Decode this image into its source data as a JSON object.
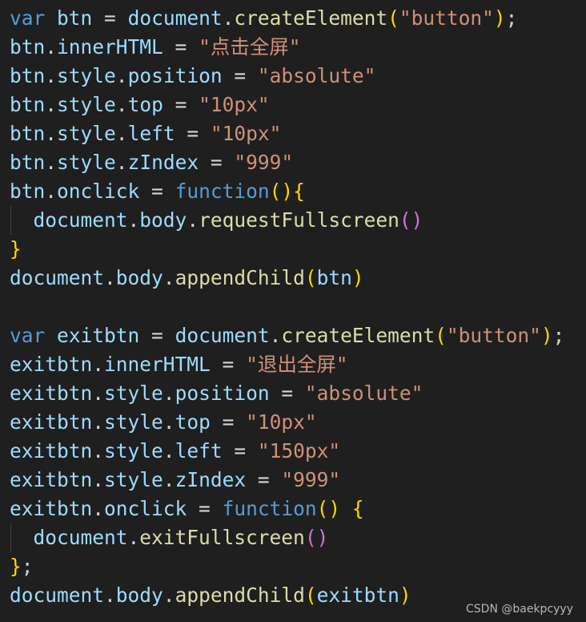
{
  "colors": {
    "background": "#1f1f1f",
    "keyword": "#569cd6",
    "variable": "#9cdcfe",
    "function": "#dcdcaa",
    "string": "#ce9178",
    "operator": "#d4d4d4",
    "bracket_level_1": "#ffd700",
    "bracket_level_2": "#da70d6",
    "indent_guide": "#404040"
  },
  "code": {
    "lines": [
      {
        "indent": false,
        "tokens": [
          [
            "var",
            "kw"
          ],
          [
            " ",
            "op"
          ],
          [
            "btn",
            "var"
          ],
          [
            " = ",
            "op"
          ],
          [
            "document",
            "var"
          ],
          [
            ".",
            "op"
          ],
          [
            "createElement",
            "fn"
          ],
          [
            "(",
            "b1"
          ],
          [
            "\"button\"",
            "str"
          ],
          [
            ")",
            "b1"
          ],
          [
            ";",
            "op"
          ]
        ]
      },
      {
        "indent": false,
        "tokens": [
          [
            "btn",
            "var"
          ],
          [
            ".",
            "op"
          ],
          [
            "innerHTML",
            "var"
          ],
          [
            " = ",
            "op"
          ],
          [
            "\"点击全屏\"",
            "str"
          ]
        ]
      },
      {
        "indent": false,
        "tokens": [
          [
            "btn",
            "var"
          ],
          [
            ".",
            "op"
          ],
          [
            "style",
            "var"
          ],
          [
            ".",
            "op"
          ],
          [
            "position",
            "var"
          ],
          [
            " = ",
            "op"
          ],
          [
            "\"absolute\"",
            "str"
          ]
        ]
      },
      {
        "indent": false,
        "tokens": [
          [
            "btn",
            "var"
          ],
          [
            ".",
            "op"
          ],
          [
            "style",
            "var"
          ],
          [
            ".",
            "op"
          ],
          [
            "top",
            "var"
          ],
          [
            " = ",
            "op"
          ],
          [
            "\"10px\"",
            "str"
          ]
        ]
      },
      {
        "indent": false,
        "tokens": [
          [
            "btn",
            "var"
          ],
          [
            ".",
            "op"
          ],
          [
            "style",
            "var"
          ],
          [
            ".",
            "op"
          ],
          [
            "left",
            "var"
          ],
          [
            " = ",
            "op"
          ],
          [
            "\"10px\"",
            "str"
          ]
        ]
      },
      {
        "indent": false,
        "tokens": [
          [
            "btn",
            "var"
          ],
          [
            ".",
            "op"
          ],
          [
            "style",
            "var"
          ],
          [
            ".",
            "op"
          ],
          [
            "zIndex",
            "var"
          ],
          [
            " = ",
            "op"
          ],
          [
            "\"999\"",
            "str"
          ]
        ]
      },
      {
        "indent": false,
        "tokens": [
          [
            "btn",
            "var"
          ],
          [
            ".",
            "op"
          ],
          [
            "onclick",
            "var"
          ],
          [
            " = ",
            "op"
          ],
          [
            "function",
            "kw"
          ],
          [
            "()",
            "b1"
          ],
          [
            "{",
            "b1"
          ]
        ]
      },
      {
        "indent": true,
        "tokens": [
          [
            "  ",
            "op"
          ],
          [
            "document",
            "var"
          ],
          [
            ".",
            "op"
          ],
          [
            "body",
            "var"
          ],
          [
            ".",
            "op"
          ],
          [
            "requestFullscreen",
            "fn"
          ],
          [
            "()",
            "b2"
          ]
        ]
      },
      {
        "indent": false,
        "tokens": [
          [
            "}",
            "b1"
          ]
        ]
      },
      {
        "indent": false,
        "tokens": [
          [
            "document",
            "var"
          ],
          [
            ".",
            "op"
          ],
          [
            "body",
            "var"
          ],
          [
            ".",
            "op"
          ],
          [
            "appendChild",
            "fn"
          ],
          [
            "(",
            "b1"
          ],
          [
            "btn",
            "var"
          ],
          [
            ")",
            "b1"
          ]
        ]
      },
      {
        "indent": false,
        "tokens": []
      },
      {
        "indent": false,
        "tokens": [
          [
            "var",
            "kw"
          ],
          [
            " ",
            "op"
          ],
          [
            "exitbtn",
            "var"
          ],
          [
            " = ",
            "op"
          ],
          [
            "document",
            "var"
          ],
          [
            ".",
            "op"
          ],
          [
            "createElement",
            "fn"
          ],
          [
            "(",
            "b1"
          ],
          [
            "\"button\"",
            "str"
          ],
          [
            ")",
            "b1"
          ],
          [
            ";",
            "op"
          ]
        ]
      },
      {
        "indent": false,
        "tokens": [
          [
            "exitbtn",
            "var"
          ],
          [
            ".",
            "op"
          ],
          [
            "innerHTML",
            "var"
          ],
          [
            " = ",
            "op"
          ],
          [
            "\"退出全屏\"",
            "str"
          ]
        ]
      },
      {
        "indent": false,
        "tokens": [
          [
            "exitbtn",
            "var"
          ],
          [
            ".",
            "op"
          ],
          [
            "style",
            "var"
          ],
          [
            ".",
            "op"
          ],
          [
            "position",
            "var"
          ],
          [
            " = ",
            "op"
          ],
          [
            "\"absolute\"",
            "str"
          ]
        ]
      },
      {
        "indent": false,
        "tokens": [
          [
            "exitbtn",
            "var"
          ],
          [
            ".",
            "op"
          ],
          [
            "style",
            "var"
          ],
          [
            ".",
            "op"
          ],
          [
            "top",
            "var"
          ],
          [
            " = ",
            "op"
          ],
          [
            "\"10px\"",
            "str"
          ]
        ]
      },
      {
        "indent": false,
        "tokens": [
          [
            "exitbtn",
            "var"
          ],
          [
            ".",
            "op"
          ],
          [
            "style",
            "var"
          ],
          [
            ".",
            "op"
          ],
          [
            "left",
            "var"
          ],
          [
            " = ",
            "op"
          ],
          [
            "\"150px\"",
            "str"
          ]
        ]
      },
      {
        "indent": false,
        "tokens": [
          [
            "exitbtn",
            "var"
          ],
          [
            ".",
            "op"
          ],
          [
            "style",
            "var"
          ],
          [
            ".",
            "op"
          ],
          [
            "zIndex",
            "var"
          ],
          [
            " = ",
            "op"
          ],
          [
            "\"999\"",
            "str"
          ]
        ]
      },
      {
        "indent": false,
        "tokens": [
          [
            "exitbtn",
            "var"
          ],
          [
            ".",
            "op"
          ],
          [
            "onclick",
            "var"
          ],
          [
            " = ",
            "op"
          ],
          [
            "function",
            "kw"
          ],
          [
            "()",
            "b1"
          ],
          [
            " ",
            "op"
          ],
          [
            "{",
            "b1"
          ]
        ]
      },
      {
        "indent": true,
        "tokens": [
          [
            "  ",
            "op"
          ],
          [
            "document",
            "var"
          ],
          [
            ".",
            "op"
          ],
          [
            "exitFullscreen",
            "fn"
          ],
          [
            "()",
            "b2"
          ]
        ]
      },
      {
        "indent": false,
        "tokens": [
          [
            "}",
            "b1"
          ],
          [
            ";",
            "op"
          ]
        ]
      },
      {
        "indent": false,
        "tokens": [
          [
            "document",
            "var"
          ],
          [
            ".",
            "op"
          ],
          [
            "body",
            "var"
          ],
          [
            ".",
            "op"
          ],
          [
            "appendChild",
            "fn"
          ],
          [
            "(",
            "b1"
          ],
          [
            "exitbtn",
            "var"
          ],
          [
            ")",
            "b1"
          ]
        ]
      }
    ]
  },
  "watermark": {
    "text": "CSDN @baekpcyyy"
  }
}
